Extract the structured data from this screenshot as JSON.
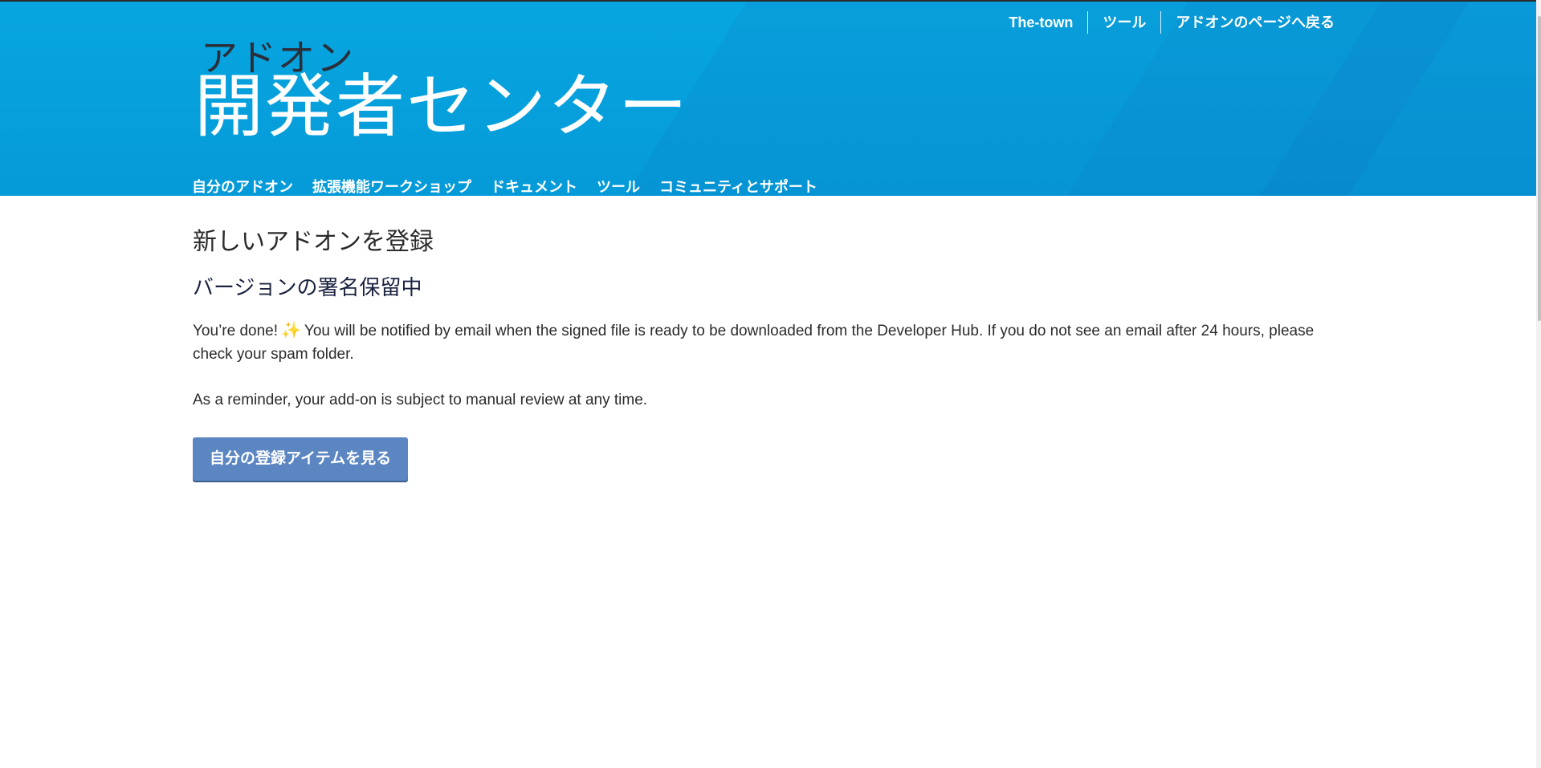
{
  "header": {
    "top_links": [
      "The-town",
      "ツール",
      "アドオンのページへ戻る"
    ],
    "logo_small": "アドオン",
    "logo_big": "開発者センター",
    "nav": [
      "自分のアドオン",
      "拡張機能ワークショップ",
      "ドキュメント",
      "ツール",
      "コミュニティとサポート"
    ]
  },
  "main": {
    "title": "新しいアドオンを登録",
    "subtitle": "バージョンの署名保留中",
    "done_text": "You’re done!",
    "message": "You will be notified by email when the signed file is ready to be downloaded from the Developer Hub. If you do not see an email after 24 hours, please check your spam folder.",
    "reminder": "As a reminder, your add-on is subject to manual review at any time.",
    "button_label": "自分の登録アイテムを見る"
  },
  "colors": {
    "header_bg": "#07a6e0",
    "button_bg": "#5b86c2",
    "logo_small_color": "#2a2f3a"
  }
}
